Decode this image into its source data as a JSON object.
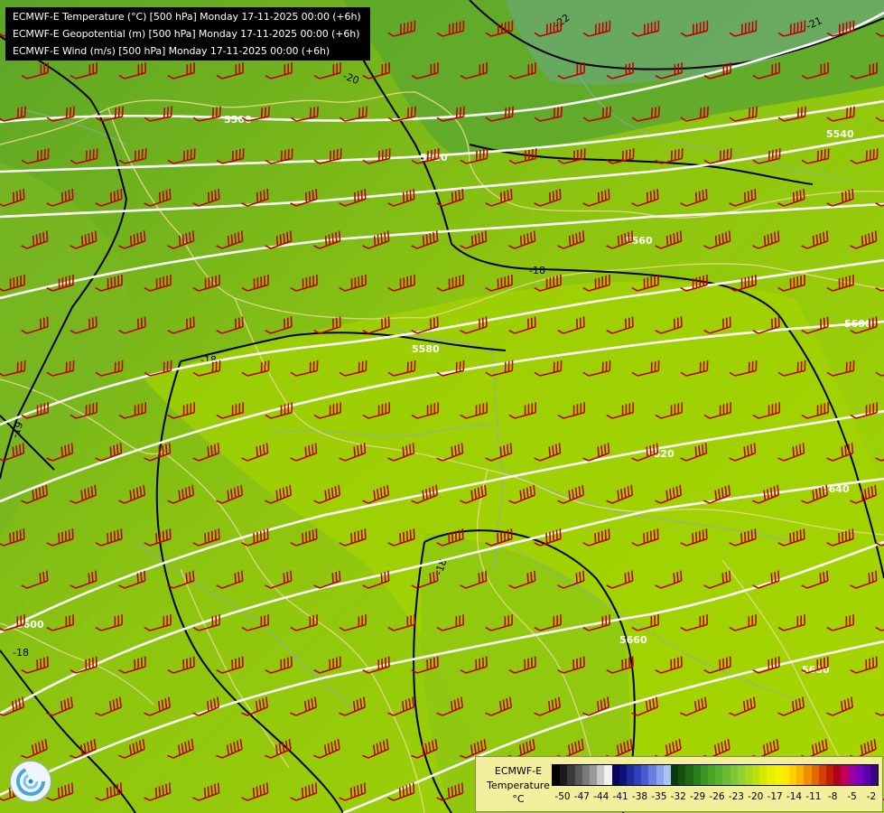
{
  "titles": [
    "ECMWF-E Temperature (°C) [500 hPa] Monday 17-11-2025 00:00 (+6h)",
    "ECMWF-E Geopotential (m) [500 hPa] Monday 17-11-2025 00:00 (+6h)",
    "ECMWF-E Wind (m/s) [500 hPa] Monday 17-11-2025 00:00 (+6h)"
  ],
  "geopotential_labels": [
    "5500",
    "5520",
    "5540",
    "5560",
    "5580",
    "5600",
    "5620",
    "5640",
    "5660",
    "5680"
  ],
  "temperature_labels": [
    "-18",
    "-19",
    "-20",
    "-21",
    "-22"
  ],
  "legend": {
    "line1": "ECMWF-E",
    "line2": "Temperature",
    "line3": "°C",
    "tick_labels": [
      "-50",
      "-47",
      "-44",
      "-41",
      "-38",
      "-35",
      "-32",
      "-29",
      "-26",
      "-23",
      "-20",
      "-17",
      "-14",
      "-11",
      "-8",
      "-5",
      "-2"
    ],
    "colors": [
      "#000000",
      "#1a1a1a",
      "#3a3a3a",
      "#5a5a5a",
      "#7a7a7a",
      "#9a9a9a",
      "#c8c8c8",
      "#f0f0f0",
      "#06065a",
      "#10107a",
      "#202a9a",
      "#3040b8",
      "#4a5cd0",
      "#6a80e0",
      "#8aa4ee",
      "#a8c4f6",
      "#0a3a0a",
      "#14520e",
      "#1e6a14",
      "#2a801a",
      "#3a9420",
      "#4aa428",
      "#5ab030",
      "#6abc34",
      "#7cc638",
      "#90d030",
      "#a6d820",
      "#bee010",
      "#d4e800",
      "#e8ee00",
      "#f4f200",
      "#fce800",
      "#fcd000",
      "#f8b400",
      "#f09000",
      "#e06a00",
      "#d04000",
      "#c01c00",
      "#b0001c",
      "#c0005a",
      "#9a00a0",
      "#7a00c0",
      "#5a00b0",
      "#3a0080"
    ]
  },
  "wind_barb_color": "#c00000",
  "contour_color_geopotential": "#ffffff",
  "contour_color_temperature": "#000000",
  "border_color": "#e6d88c",
  "river_color": "#8aa8c8",
  "logo_icon": "ecmwf-swirl-icon"
}
